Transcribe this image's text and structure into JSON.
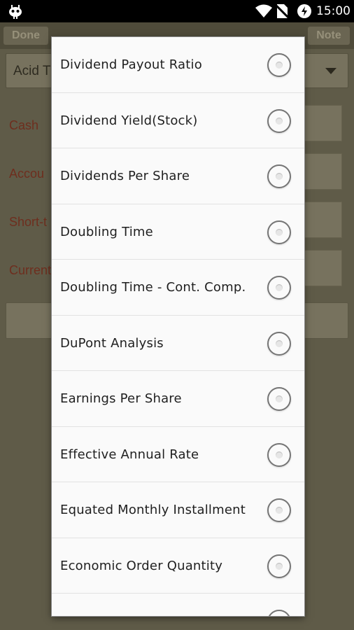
{
  "status_bar": {
    "time": "15:00",
    "icons": [
      "android-debug-icon",
      "wifi-icon",
      "no-sim-icon",
      "battery-charging-icon"
    ]
  },
  "background_app": {
    "toolbar": {
      "done_label": "Done",
      "note_label": "Note"
    },
    "spinner_value": "Acid T",
    "fields": [
      {
        "label": "Cash"
      },
      {
        "label": "Accou"
      },
      {
        "label": "Short-t"
      },
      {
        "label": "Current"
      }
    ]
  },
  "dialog": {
    "options": [
      {
        "label": "Dividend Payout Ratio",
        "selected": false
      },
      {
        "label": "Dividend Yield(Stock)",
        "selected": false
      },
      {
        "label": "Dividends Per Share",
        "selected": false
      },
      {
        "label": "Doubling Time",
        "selected": false
      },
      {
        "label": "Doubling Time - Cont. Comp.",
        "selected": false
      },
      {
        "label": "DuPont Analysis",
        "selected": false
      },
      {
        "label": "Earnings Per Share",
        "selected": false
      },
      {
        "label": "Effective Annual Rate",
        "selected": false
      },
      {
        "label": "Equated Monthly Installment",
        "selected": false
      },
      {
        "label": "Economic Order Quantity",
        "selected": false
      }
    ]
  },
  "colors": {
    "dim_overlay": "#5e5a46",
    "label_text": "#6e2e1e",
    "dialog_bg": "#fafafa"
  }
}
